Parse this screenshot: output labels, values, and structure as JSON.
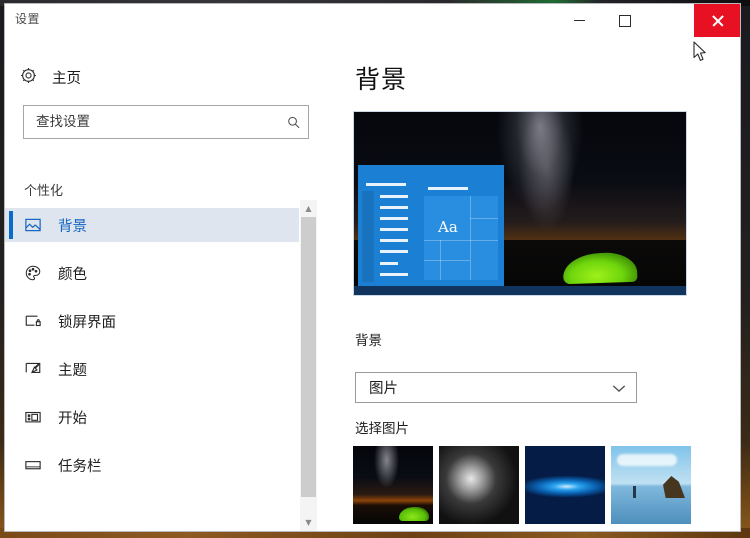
{
  "window": {
    "title": "设置",
    "controls": {
      "minimize_label": "最小化",
      "maximize_label": "最大化",
      "close_label": "关闭",
      "close_hover_color": "#e81123"
    }
  },
  "sidebar": {
    "home_label": "主页",
    "home_icon": "gear-icon",
    "search": {
      "placeholder": "查找设置",
      "value": "",
      "icon": "search-icon"
    },
    "group_title": "个性化",
    "items": [
      {
        "label": "背景",
        "icon": "picture-icon",
        "selected": true
      },
      {
        "label": "颜色",
        "icon": "palette-icon",
        "selected": false
      },
      {
        "label": "锁屏界面",
        "icon": "lock-screen-icon",
        "selected": false
      },
      {
        "label": "主题",
        "icon": "theme-brush-icon",
        "selected": false
      },
      {
        "label": "开始",
        "icon": "start-menu-icon",
        "selected": false
      },
      {
        "label": "任务栏",
        "icon": "taskbar-icon",
        "selected": false
      }
    ],
    "accent_color": "#0b6bcb",
    "selected_bg": "#dfe5ee",
    "selected_text_color": "#1565c0",
    "scrollbar": {
      "up_arrow": "▲",
      "down_arrow": "▼"
    }
  },
  "content": {
    "page_title": "背景",
    "preview": {
      "alt": "桌面预览：夜空银河与绿色帐篷",
      "start_menu_tile_text": "Aa"
    },
    "background_section": {
      "label": "背景",
      "select_value": "图片",
      "select_icon": "chevron-down-icon"
    },
    "choose_picture": {
      "label": "选择图片",
      "thumbnails": [
        {
          "name": "银河帐篷"
        },
        {
          "name": "晶体特写"
        },
        {
          "name": "Windows 蓝色光辉"
        },
        {
          "name": "海滩礁石"
        }
      ]
    }
  },
  "cursor": {
    "icon": "mouse-pointer-icon"
  }
}
